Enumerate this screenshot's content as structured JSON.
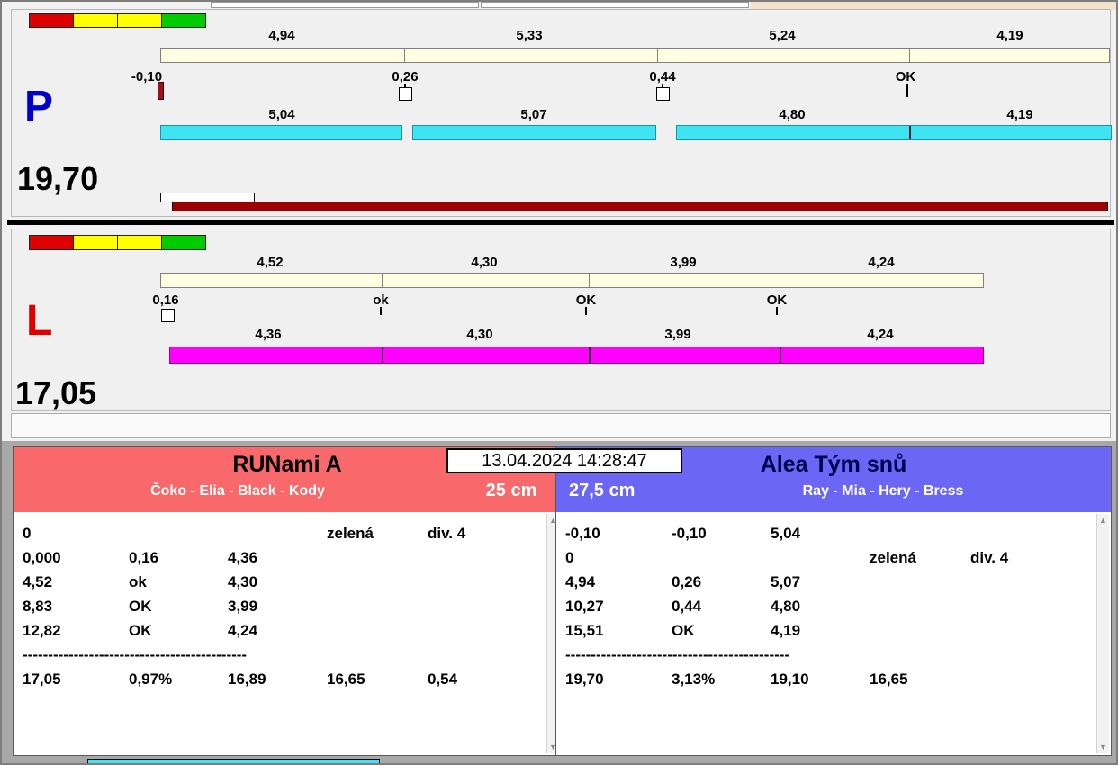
{
  "panel_p": {
    "letter": "P",
    "letter_color": "#0000cc",
    "total": "19,70",
    "status_segments": [
      "#dd0000",
      "#ffff00",
      "#ffff00",
      "#00cc00"
    ],
    "split_values": [
      "4,94",
      "5,33",
      "5,24",
      "4,19"
    ],
    "markers": [
      "-0,10",
      "0,26",
      "0,44",
      "OK"
    ],
    "leg_values": [
      "5,04",
      "5,07",
      "4,80",
      "4,19"
    ],
    "bar_color": "#3fe3f2",
    "progress_color": "#9c0000"
  },
  "panel_l": {
    "letter": "L",
    "letter_color": "#e00000",
    "total": "17,05",
    "status_segments": [
      "#dd0000",
      "#ffff00",
      "#ffff00",
      "#00cc00"
    ],
    "split_values": [
      "4,52",
      "4,30",
      "3,99",
      "4,24"
    ],
    "markers": [
      "0,16",
      "ok",
      "OK",
      "OK"
    ],
    "leg_values": [
      "4,36",
      "4,30",
      "3,99",
      "4,24"
    ],
    "bar_color": "#ff00ff"
  },
  "scoreboard": {
    "datetime": "13.04.2024 14:28:47",
    "left": {
      "team": "RUNami A",
      "members": "Čoko - Elia - Black - Kody",
      "height": "25 cm",
      "header_color": "#f9696b",
      "rows": [
        [
          "0",
          "",
          "",
          "zelená",
          "div. 4"
        ],
        [
          "0,000",
          "0,16",
          "4,36",
          "",
          ""
        ],
        [
          "4,52",
          "ok",
          "4,30",
          "",
          ""
        ],
        [
          "8,83",
          "OK",
          "3,99",
          "",
          ""
        ],
        [
          "12,82",
          "OK",
          "4,24",
          "",
          ""
        ]
      ],
      "separator": "--------------------------------------------",
      "summary": [
        "17,05",
        "0,97%",
        "16,89",
        "16,65",
        "0,54"
      ]
    },
    "right": {
      "team": "Alea Tým snů",
      "members": "Ray - Mia - Hery - Bress",
      "height": "27,5 cm",
      "header_color": "#6b66f3",
      "rows": [
        [
          "-0,10",
          "-0,10",
          "5,04",
          "",
          ""
        ],
        [
          "0",
          "",
          "",
          "zelená",
          "div. 4"
        ],
        [
          "4,94",
          "0,26",
          "5,07",
          "",
          ""
        ],
        [
          "10,27",
          "0,44",
          "4,80",
          "",
          ""
        ],
        [
          "15,51",
          "OK",
          "4,19",
          "",
          ""
        ]
      ],
      "separator": "--------------------------------------------",
      "summary": [
        "19,70",
        "3,13%",
        "19,10",
        "16,65",
        ""
      ]
    },
    "scroll_up_glyph": "▲",
    "scroll_down_glyph": "▼"
  }
}
